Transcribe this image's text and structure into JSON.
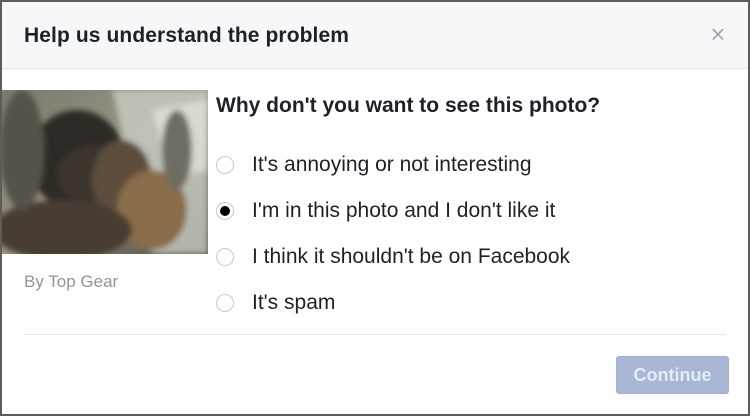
{
  "dialog": {
    "title": "Help us understand the problem",
    "close_icon": "×"
  },
  "photo": {
    "credit": "By Top Gear"
  },
  "question": "Why don't you want to see this photo?",
  "options": [
    {
      "label": "It's annoying or not interesting",
      "selected": false
    },
    {
      "label": "I'm in this photo and I don't like it",
      "selected": true
    },
    {
      "label": "I think it shouldn't be on Facebook",
      "selected": false
    },
    {
      "label": "It's spam",
      "selected": false
    }
  ],
  "footer": {
    "continue_label": "Continue"
  },
  "colors": {
    "header_bg": "#f6f7f9",
    "button_disabled": "#a9b7d6",
    "text": "#1d2129",
    "muted": "#90949c"
  }
}
